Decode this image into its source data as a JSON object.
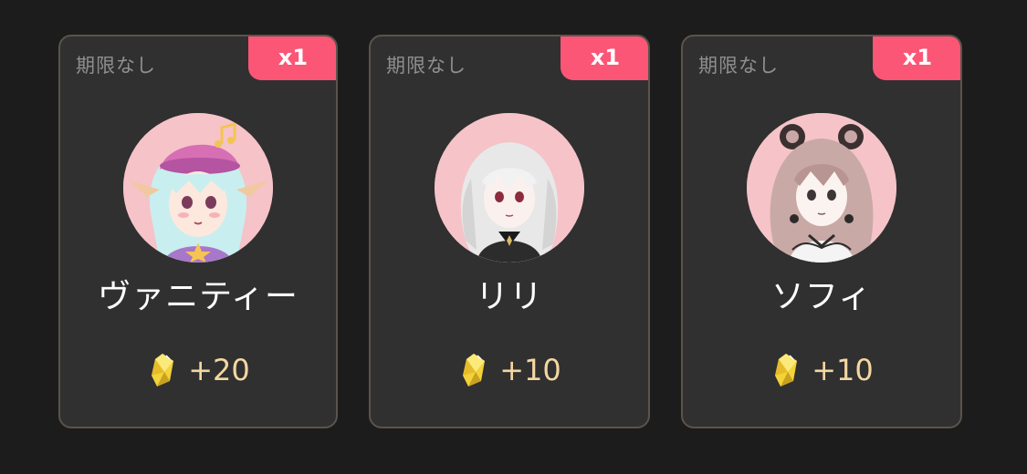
{
  "cards": [
    {
      "expiry": "期限なし",
      "quantity": "x1",
      "avatar_icon": "character-avatar-vanity",
      "name": "ヴァニティー",
      "reward_icon": "crystal-gem-icon",
      "reward": "+20"
    },
    {
      "expiry": "期限なし",
      "quantity": "x1",
      "avatar_icon": "character-avatar-lily",
      "name": "リリ",
      "reward_icon": "crystal-gem-icon",
      "reward": "+10"
    },
    {
      "expiry": "期限なし",
      "quantity": "x1",
      "avatar_icon": "character-avatar-sophie",
      "name": "ソフィ",
      "reward_icon": "crystal-gem-icon",
      "reward": "+10"
    }
  ],
  "colors": {
    "background": "#1c1c1c",
    "card": "#303030",
    "card_border": "#5b544b",
    "badge": "#fb5676",
    "avatar_bg": "#f5c3c8",
    "reward_text": "#f3d7a2"
  }
}
